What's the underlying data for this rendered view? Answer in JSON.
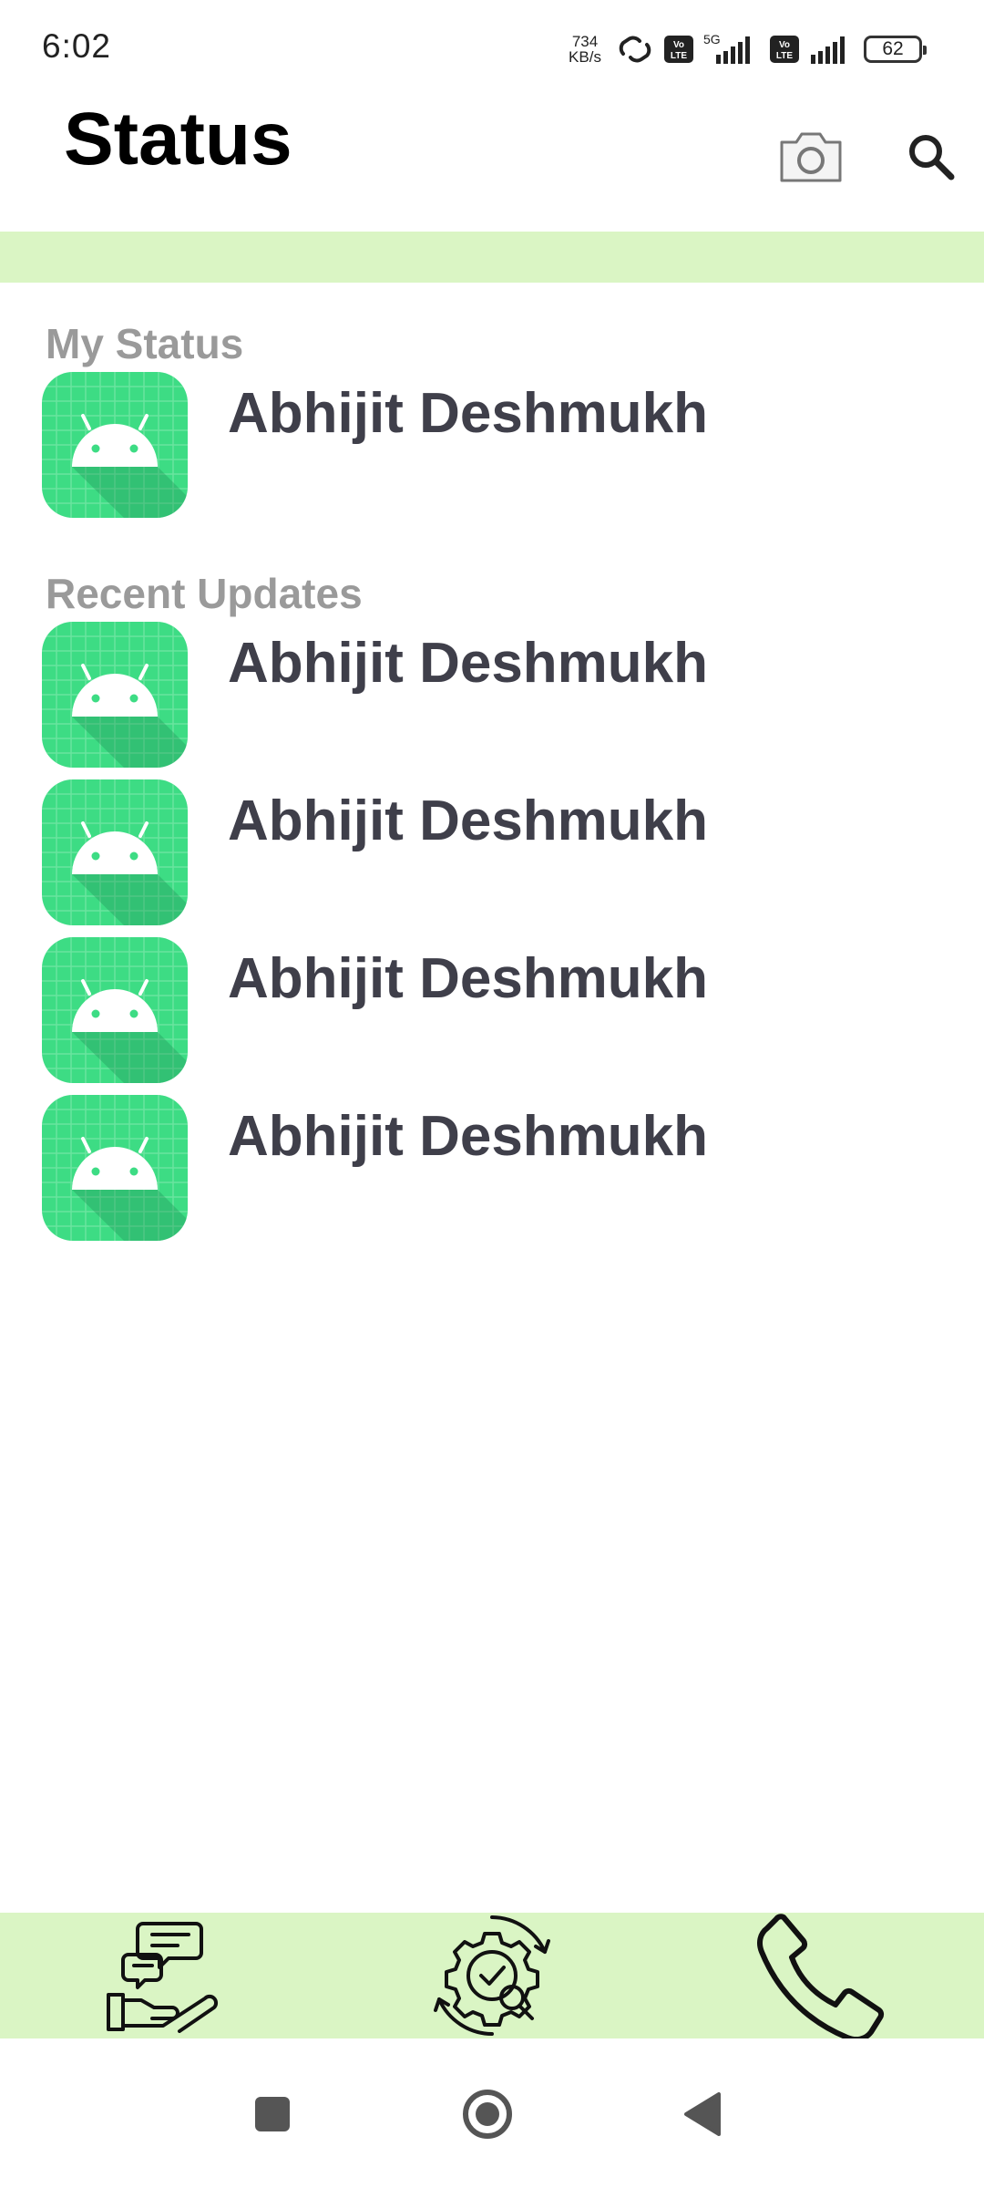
{
  "status_bar": {
    "time": "6:02",
    "net_speed_value": "734",
    "net_speed_unit": "KB/s",
    "network": "5G",
    "volte_label": "Vo LTE",
    "battery": "62"
  },
  "header": {
    "title": "Status",
    "camera_icon": "camera-icon",
    "search_icon": "search-icon"
  },
  "my_status": {
    "label": "My Status",
    "name": "Abhijit Deshmukh"
  },
  "recent_updates": {
    "label": "Recent Updates",
    "items": [
      {
        "name": "Abhijit Deshmukh"
      },
      {
        "name": "Abhijit Deshmukh"
      },
      {
        "name": "Abhijit Deshmukh"
      },
      {
        "name": "Abhijit Deshmukh"
      }
    ]
  },
  "bottom_tabs": [
    {
      "icon": "chat-hand-icon"
    },
    {
      "icon": "gear-check-icon"
    },
    {
      "icon": "phone-icon"
    }
  ],
  "system_nav": [
    "recents-square-icon",
    "home-circle-icon",
    "back-triangle-icon"
  ],
  "colors": {
    "accent_strip": "#daf5c4",
    "avatar_green": "#3ddc84",
    "name_text": "#3f3f4a",
    "section_label": "#9a9a9a"
  }
}
